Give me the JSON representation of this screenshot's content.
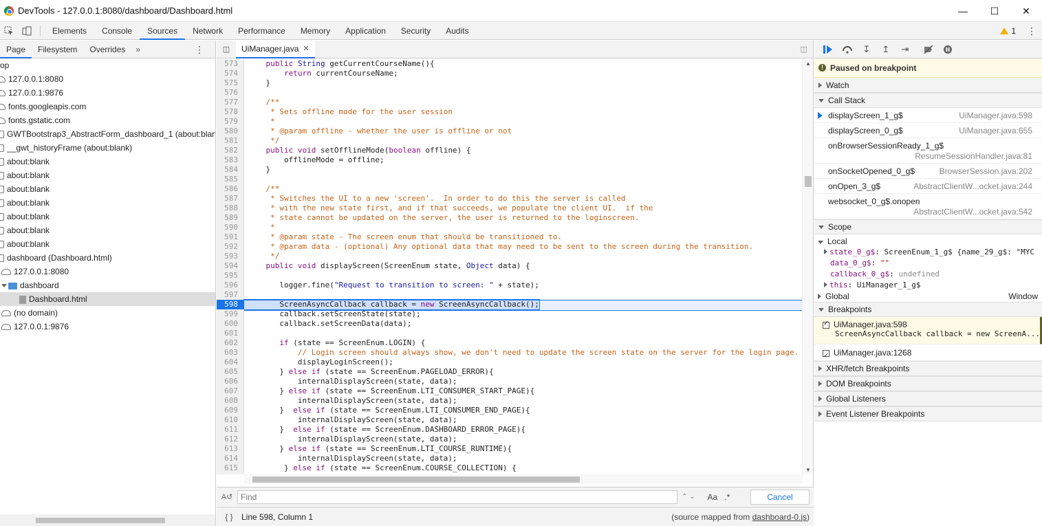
{
  "window": {
    "title": "DevTools - 127.0.0.1:8080/dashboard/Dashboard.html"
  },
  "tabs": [
    "Elements",
    "Console",
    "Sources",
    "Network",
    "Performance",
    "Memory",
    "Application",
    "Security",
    "Audits"
  ],
  "active_tab": "Sources",
  "warnings_count": "1",
  "navigator": {
    "tabs": [
      "Page",
      "Filesystem",
      "Overrides"
    ],
    "tree": [
      "op",
      "127.0.0.1:8080",
      "127.0.0.1:9876",
      "fonts.googleapis.com",
      "fonts.gstatic.com",
      "GWTBootstrap3_AbstractForm_dashboard_1 (about:blank)",
      "__gwt_historyFrame (about:blank)",
      "about:blank",
      "about:blank",
      "about:blank",
      "about:blank",
      "about:blank",
      "about:blank",
      "about:blank",
      "dashboard (Dashboard.html)",
      "127.0.0.1:8080",
      "dashboard",
      "Dashboard.html",
      "(no domain)",
      "127.0.0.1:9876"
    ]
  },
  "editor": {
    "file_tab": "UiManager.java",
    "find_placeholder": "Find",
    "find_case_label": "Aa",
    "find_regex_label": ".*",
    "cancel_label": "Cancel",
    "status": "Line 598, Column 1",
    "source_mapped_prefix": "(source mapped from ",
    "source_mapped_link": "dashboard-0.js",
    "source_mapped_suffix": ")",
    "lines": [
      {
        "n": "573",
        "t": "    public String getCurrentCourseName(){"
      },
      {
        "n": "574",
        "t": "        return currentCourseName;"
      },
      {
        "n": "575",
        "t": "    }"
      },
      {
        "n": "576",
        "t": ""
      },
      {
        "n": "577",
        "t": "    /**"
      },
      {
        "n": "578",
        "t": "     * Sets offline mode for the user session"
      },
      {
        "n": "579",
        "t": "     *"
      },
      {
        "n": "580",
        "t": "     * @param offline - whether the user is offline or not"
      },
      {
        "n": "581",
        "t": "     */"
      },
      {
        "n": "582",
        "t": "    public void setOfflineMode(boolean offline) {"
      },
      {
        "n": "583",
        "t": "        offlineMode = offline;"
      },
      {
        "n": "584",
        "t": "    }"
      },
      {
        "n": "585",
        "t": ""
      },
      {
        "n": "586",
        "t": "    /**"
      },
      {
        "n": "587",
        "t": "     * Switches the UI to a new 'screen'.  In order to do this the server is called"
      },
      {
        "n": "588",
        "t": "     * with the new state first, and if that succeeds, we populate the client UI.  if the"
      },
      {
        "n": "589",
        "t": "     * state cannot be updated on the server, the user is returned to the loginscreen."
      },
      {
        "n": "590",
        "t": "     *"
      },
      {
        "n": "591",
        "t": "     * @param state - The screen enum that should be transitioned to."
      },
      {
        "n": "592",
        "t": "     * @param data - (optional) Any optional data that may need to be sent to the screen during the transition."
      },
      {
        "n": "593",
        "t": "     */"
      },
      {
        "n": "594",
        "t": "    public void displayScreen(ScreenEnum state, Object data) {"
      },
      {
        "n": "595",
        "t": ""
      },
      {
        "n": "596",
        "t": "       logger.fine(\"Request to transition to screen: \" + state);"
      },
      {
        "n": "597",
        "t": ""
      },
      {
        "n": "598",
        "t": "       ScreenAsyncCallback callback = new ScreenAsyncCallback();"
      },
      {
        "n": "599",
        "t": "       callback.setScreenState(state);"
      },
      {
        "n": "600",
        "t": "       callback.setScreenData(data);"
      },
      {
        "n": "601",
        "t": ""
      },
      {
        "n": "602",
        "t": "       if (state == ScreenEnum.LOGIN) {"
      },
      {
        "n": "603",
        "t": "           // Login screen should always show, we don't need to update the screen state on the server for the login page."
      },
      {
        "n": "604",
        "t": "           displayLoginScreen();"
      },
      {
        "n": "605",
        "t": "       } else if (state == ScreenEnum.PAGELOAD_ERROR){"
      },
      {
        "n": "606",
        "t": "           internalDisplayScreen(state, data);"
      },
      {
        "n": "607",
        "t": "       } else if (state == ScreenEnum.LTI_CONSUMER_START_PAGE){"
      },
      {
        "n": "608",
        "t": "           internalDisplayScreen(state, data);"
      },
      {
        "n": "609",
        "t": "       }  else if (state == ScreenEnum.LTI_CONSUMER_END_PAGE){"
      },
      {
        "n": "610",
        "t": "           internalDisplayScreen(state, data);"
      },
      {
        "n": "611",
        "t": "       }  else if (state == ScreenEnum.DASHBOARD_ERROR_PAGE){"
      },
      {
        "n": "612",
        "t": "           internalDisplayScreen(state, data);"
      },
      {
        "n": "613",
        "t": "       } else if (state == ScreenEnum.LTI_COURSE_RUNTIME){"
      },
      {
        "n": "614",
        "t": "           internalDisplayScreen(state, data);"
      },
      {
        "n": "615",
        "t": "        } else if (state == ScreenEnum.COURSE_COLLECTION) {"
      },
      {
        "n": "616",
        "t": ""
      }
    ]
  },
  "debugger": {
    "paused_text": "Paused on breakpoint",
    "watch_label": "Watch",
    "callstack_label": "Call Stack",
    "frames": [
      {
        "fn": "displayScreen_1_g$",
        "loc": "UiManager.java:598"
      },
      {
        "fn": "displayScreen_0_g$",
        "loc": "UiManager.java:655"
      },
      {
        "fn": "onBrowserSessionReady_1_g$",
        "loc": "ResumeSessionHandler.java:81"
      },
      {
        "fn": "onSocketOpened_0_g$",
        "loc": "BrowserSession.java:202"
      },
      {
        "fn": "onOpen_3_g$",
        "loc": "AbstractClientW...ocket.java:244"
      },
      {
        "fn": "websocket_0_g$.onopen",
        "loc": "AbstractClientW...ocket.java:542"
      }
    ],
    "scope_label": "Scope",
    "local_label": "Local",
    "scope": [
      {
        "name": "state_0_g$",
        "value": "ScreenEnum_1_g$ {name_29_g$: \"MYC"
      },
      {
        "name": "data_0_g$",
        "value": "\"\""
      },
      {
        "name": "callback_0_g$",
        "value": "undefined"
      },
      {
        "name": "this",
        "value": "UiManager_1_g$"
      }
    ],
    "global_label": "Global",
    "global_value": "Window",
    "breakpoints_label": "Breakpoints",
    "breakpoints": [
      {
        "label": "UiManager.java:598",
        "snippet": "ScreenAsyncCallback callback = new ScreenA..."
      },
      {
        "label": "UiManager.java:1268",
        "snippet": ""
      }
    ],
    "more_sections": [
      "XHR/fetch Breakpoints",
      "DOM Breakpoints",
      "Global Listeners",
      "Event Listener Breakpoints"
    ]
  }
}
